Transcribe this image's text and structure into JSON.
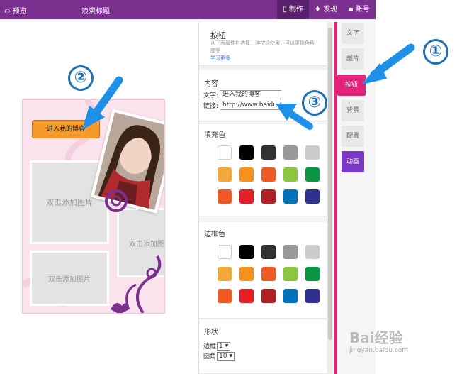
{
  "topbar": {
    "preview_label": "预览",
    "title": "浪漫标题",
    "nav": [
      {
        "label": "制作",
        "active": true
      },
      {
        "label": "发现",
        "active": false
      },
      {
        "label": "账号",
        "active": false
      }
    ]
  },
  "phone": {
    "cta_label": "进入我的博客",
    "placeholder_1": "双击添加图片",
    "placeholder_2": "双击添加图",
    "placeholder_3": "双击添加图片"
  },
  "panel": {
    "header": {
      "title": "按钮",
      "description": "从下面属性栏选择一种按钮使用，可以更换色角度等",
      "more_link": "学习更多"
    },
    "content": {
      "title": "内容",
      "text_label": "文字:",
      "text_value": "进入我的博客",
      "link_label": "链接:",
      "link_value": "http://www.baidu.com"
    },
    "fill_color": {
      "title": "填充色",
      "swatches": [
        "#ffffff",
        "#000000",
        "#333333",
        "#999999",
        "#cccccc",
        "#f5a93a",
        "#f5921e",
        "#ef5a24",
        "#8cc63e",
        "#0a9543",
        "#f15a24",
        "#e31e26",
        "#b11f24",
        "#0072bb",
        "#2e3192"
      ]
    },
    "border_color": {
      "title": "边框色",
      "swatches": [
        "#ffffff",
        "#000000",
        "#333333",
        "#999999",
        "#cccccc",
        "#f5a93a",
        "#f5921e",
        "#ef5a24",
        "#8cc63e",
        "#0a9543",
        "#f15a24",
        "#e31e26",
        "#b11f24",
        "#0072bb",
        "#2e3192"
      ]
    },
    "shape": {
      "title": "形状",
      "border_label": "边框",
      "border_value": "1",
      "radius_label": "圆角",
      "radius_value": "10"
    }
  },
  "rtabs": [
    {
      "label": "文字"
    },
    {
      "label": "图片"
    },
    {
      "label": "按钮"
    },
    {
      "label": "背景"
    },
    {
      "label": "配置"
    },
    {
      "label": "动画"
    }
  ],
  "callouts": [
    "①",
    "②",
    "③"
  ],
  "watermark": {
    "brand": "Bai经验",
    "url": "jingyan.baidu.com"
  }
}
